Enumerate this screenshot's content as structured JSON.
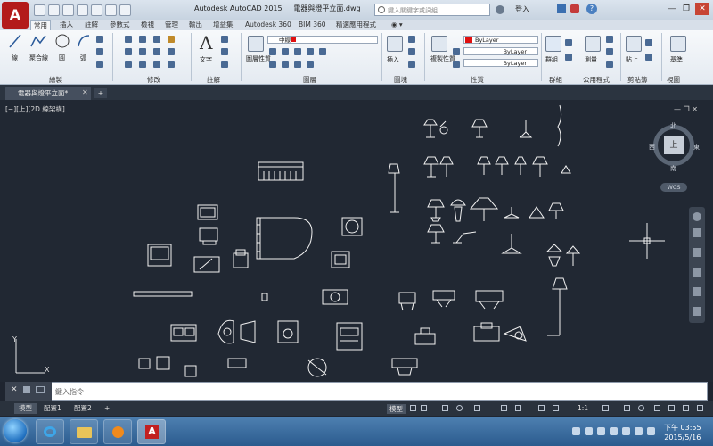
{
  "app": {
    "title": "Autodesk AutoCAD 2015",
    "file": "電器與燈平立面.dwg",
    "search_placeholder": "鍵入關鍵字或詞組",
    "login": "登入",
    "app_button": "A"
  },
  "ribbon_tabs": [
    "常用",
    "插入",
    "註解",
    "參數式",
    "檢視",
    "管理",
    "輸出",
    "增益集",
    "Autodesk 360",
    "BIM 360",
    "精選應用程式"
  ],
  "ribbon": {
    "draw": {
      "title": "繪製",
      "line": "線",
      "polyline": "聚合線",
      "circle": "圓",
      "arc": "弧"
    },
    "modify": {
      "title": "修改"
    },
    "annotation": {
      "title": "註解",
      "text": "文字"
    },
    "layers": {
      "title": "圖層",
      "props": "圖層性質",
      "layer_name": "中線"
    },
    "block": {
      "title": "圖塊",
      "insert": "插入"
    },
    "properties": {
      "title": "性質",
      "match": "複製性質",
      "color": "ByLayer",
      "linetype": "ByLayer",
      "lineweight": "ByLayer"
    },
    "groups": {
      "title": "群組",
      "group": "群組"
    },
    "utilities": {
      "title": "公用程式",
      "measure": "測量"
    },
    "clipboard": {
      "title": "剪貼簿",
      "paste": "貼上"
    },
    "view": {
      "title": "視圖",
      "base": "基準"
    }
  },
  "doc_tab": "電器與燈平立面*",
  "viewport": {
    "label": "[−][上][2D 線架構]",
    "controls": "— ❐ ✕"
  },
  "viewcube": {
    "north": "北",
    "south": "南",
    "east": "東",
    "west": "西",
    "top": "上",
    "wcs": "WCS"
  },
  "ucs": {
    "x": "X",
    "y": "Y"
  },
  "command": {
    "placeholder": "鍵入指令"
  },
  "layout_tabs": [
    "模型",
    "配置1",
    "配置2"
  ],
  "status": {
    "model": "模型",
    "scale": "1:1"
  },
  "clock": {
    "time": "下午 03:55",
    "date": "2015/5/16"
  },
  "colors": {
    "canvas": "#212833",
    "geometry": "#f2f2f2",
    "accent": "#b31b1b",
    "bylayer_red": "#e01010"
  }
}
